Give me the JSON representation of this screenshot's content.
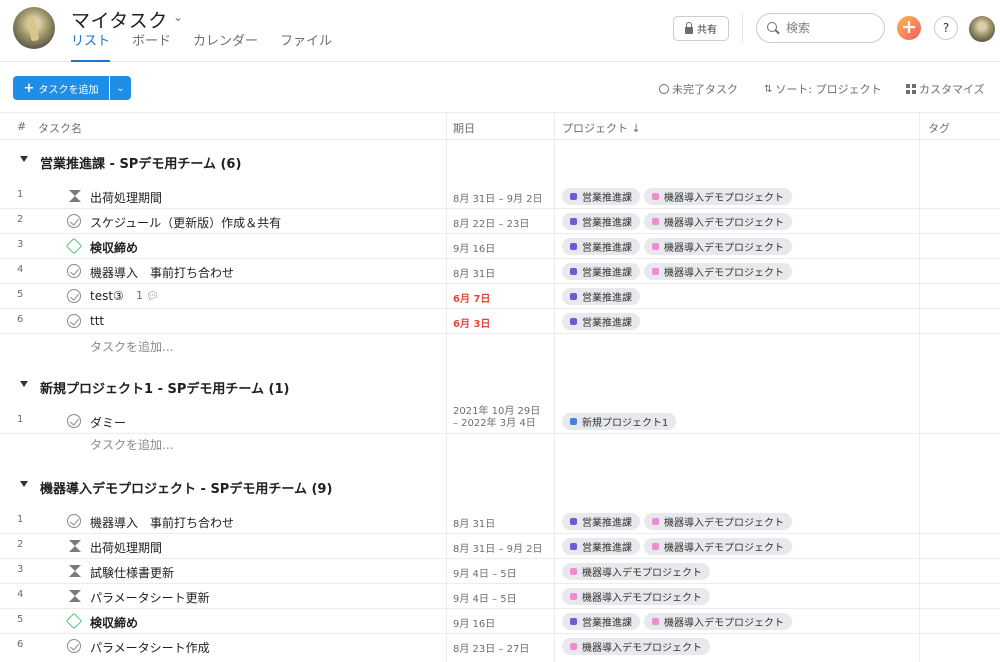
{
  "header": {
    "title": "マイタスク",
    "tabs": [
      "リスト",
      "ボード",
      "カレンダー",
      "ファイル"
    ],
    "share_label": "共有",
    "search_placeholder": "検索",
    "add_symbol": "+",
    "help_symbol": "?"
  },
  "toolbar": {
    "add_task_label": "タスクを追加",
    "filter_label": "未完了タスク",
    "sort_label": "ソート: プロジェクト",
    "customize_label": "カスタマイズ"
  },
  "columns": {
    "num": "#",
    "task": "タスク名",
    "due": "期日",
    "project": "プロジェクト ↓",
    "tag": "タグ"
  },
  "colors": {
    "accent": "#1e8ee6",
    "overdue": "#e0483a",
    "milestone": "#3bb85a",
    "project_eigyo": "#6e5bd8",
    "project_kiki": "#f08bd2",
    "project_shinki": "#4a7fd6"
  },
  "add_task_text": "タスクを追加...",
  "sections": [
    {
      "title": "営業推進課 - SPデモ用チーム (6)",
      "rows": [
        {
          "num": "1",
          "icon": "hourglass-icon",
          "name": "出荷処理期間",
          "due": "8月 31日 – 9月 2日",
          "overdue": false,
          "projects": [
            "営業推進課",
            "機器導入デモプロジェクト"
          ]
        },
        {
          "num": "2",
          "icon": "check-circle-icon",
          "name": "スケジュール（更新版）作成＆共有",
          "due": "8月 22日 – 23日",
          "overdue": false,
          "projects": [
            "営業推進課",
            "機器導入デモプロジェクト"
          ]
        },
        {
          "num": "3",
          "icon": "milestone-icon",
          "name": "検収締め",
          "bold": true,
          "due": "9月 16日",
          "overdue": false,
          "projects": [
            "営業推進課",
            "機器導入デモプロジェクト"
          ]
        },
        {
          "num": "4",
          "icon": "check-circle-icon",
          "name": "機器導入　事前打ち合わせ",
          "due": "8月 31日",
          "overdue": false,
          "projects": [
            "営業推進課",
            "機器導入デモプロジェクト"
          ]
        },
        {
          "num": "5",
          "icon": "check-circle-icon",
          "name": "test③",
          "comments": "1",
          "due": "6月 7日",
          "overdue": true,
          "projects": [
            "営業推進課"
          ]
        },
        {
          "num": "6",
          "icon": "check-circle-icon",
          "name": "ttt",
          "due": "6月 3日",
          "overdue": true,
          "projects": [
            "営業推進課"
          ]
        }
      ]
    },
    {
      "title": "新規プロジェクト1 - SPデモ用チーム (1)",
      "rows": [
        {
          "num": "1",
          "icon": "check-circle-icon",
          "name": "ダミー",
          "due": "2021年 10月 29日",
          "due2": "– 2022年 3月 4日",
          "overdue": false,
          "projects": [
            "新規プロジェクト1"
          ]
        }
      ]
    },
    {
      "title": "機器導入デモプロジェクト - SPデモ用チーム (9)",
      "rows": [
        {
          "num": "1",
          "icon": "check-circle-icon",
          "name": "機器導入　事前打ち合わせ",
          "due": "8月 31日",
          "overdue": false,
          "projects": [
            "営業推進課",
            "機器導入デモプロジェクト"
          ]
        },
        {
          "num": "2",
          "icon": "hourglass-icon",
          "name": "出荷処理期間",
          "due": "8月 31日 – 9月 2日",
          "overdue": false,
          "projects": [
            "営業推進課",
            "機器導入デモプロジェクト"
          ]
        },
        {
          "num": "3",
          "icon": "hourglass-icon",
          "name": "試験仕様書更新",
          "due": "9月 4日 – 5日",
          "overdue": false,
          "projects": [
            "機器導入デモプロジェクト"
          ]
        },
        {
          "num": "4",
          "icon": "hourglass-icon",
          "name": "パラメータシート更新",
          "due": "9月 4日 – 5日",
          "overdue": false,
          "projects": [
            "機器導入デモプロジェクト"
          ]
        },
        {
          "num": "5",
          "icon": "milestone-icon",
          "name": "検収締め",
          "bold": true,
          "due": "9月 16日",
          "overdue": false,
          "projects": [
            "営業推進課",
            "機器導入デモプロジェクト"
          ]
        },
        {
          "num": "6",
          "icon": "check-circle-icon",
          "name": "パラメータシート作成",
          "due": "8月 23日 – 27日",
          "overdue": false,
          "projects": [
            "機器導入デモプロジェクト"
          ]
        }
      ]
    }
  ]
}
